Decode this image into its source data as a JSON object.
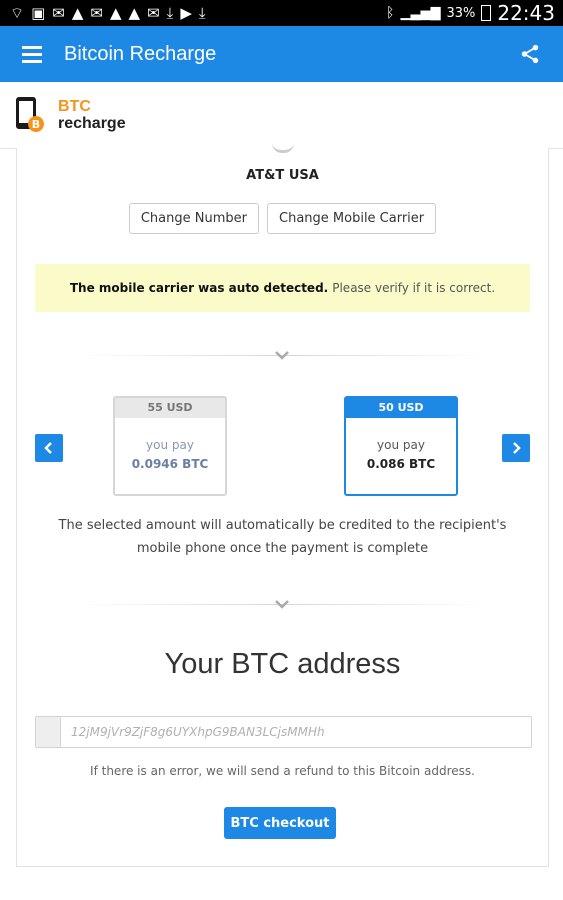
{
  "status_bar": {
    "time": "22:43",
    "battery": "33%",
    "left_icons": [
      "wifi-icon",
      "sim-icon",
      "mail-icon",
      "alert-icon",
      "mail-icon",
      "alert-icon",
      "alert-icon",
      "mail-icon",
      "download-icon",
      "youtube-icon",
      "download-icon"
    ]
  },
  "app_bar": {
    "title": "Bitcoin Recharge",
    "menu_icon": "hamburger-menu-icon",
    "share_icon": "share-icon",
    "color": "#1e88e5"
  },
  "logo": {
    "line1": "BTC",
    "line2": "recharge",
    "accent": "#f7931a"
  },
  "operator": {
    "name": "AT&T USA",
    "change_number_label": "Change Number",
    "change_carrier_label": "Change Mobile Carrier"
  },
  "notice": {
    "bold": "The mobile carrier was auto detected.",
    "rest": "Please verify if it is correct.",
    "bg_color": "#fafbc8"
  },
  "plans": [
    {
      "header": "55 USD",
      "pay_label": "you pay",
      "amount": "0.0946 BTC",
      "selected": false
    },
    {
      "header": "50 USD",
      "pay_label": "you pay",
      "amount": "0.086 BTC",
      "selected": true
    }
  ],
  "amount_info": {
    "line1": "The selected amount will automatically be credited to the recipient's",
    "line2": "mobile phone once the payment is complete"
  },
  "address": {
    "title": "Your BTC address",
    "placeholder": "12jM9jVr9ZjF8g6UYXhpG9BAN3LCjsMMHh",
    "refund_note": "If there is an error, we will send a refund to this Bitcoin address.",
    "checkout_label": "BTC checkout"
  }
}
